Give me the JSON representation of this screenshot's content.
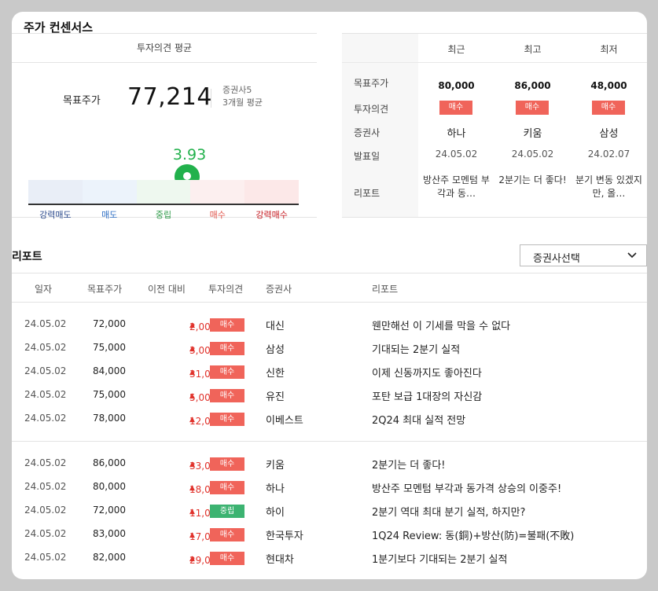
{
  "title": "주가 컨센서스",
  "summary": {
    "heading": "투자의견 평균",
    "target_label": "목표주가",
    "target_value": "77,214",
    "broker_count": "증권사5",
    "period": "3개월 평균",
    "score": "3.93",
    "score_fraction": 0.587,
    "gauge_labels": [
      "강력매도",
      "매도",
      "중립",
      "매수",
      "강력매수"
    ]
  },
  "comparison": {
    "row_labels": [
      "목표주가",
      "투자의견",
      "증권사",
      "발표일",
      "리포트"
    ],
    "columns": [
      {
        "header": "최근",
        "price": "80,000",
        "opinion": "매수",
        "broker": "하나",
        "date": "24.05.02",
        "report": "방산주 모멘텀 부각과 동…"
      },
      {
        "header": "최고",
        "price": "86,000",
        "opinion": "매수",
        "broker": "키움",
        "date": "24.05.02",
        "report": "2분기는 더 좋다!"
      },
      {
        "header": "최저",
        "price": "48,000",
        "opinion": "매수",
        "broker": "삼성",
        "date": "24.02.07",
        "report": "분기 변동 있겠지만, 올…"
      }
    ]
  },
  "reports": {
    "title": "리포트",
    "broker_select": "증권사선택",
    "headers": [
      "일자",
      "목표주가",
      "이전 대비",
      "투자의견",
      "증권사",
      "리포트"
    ],
    "rows": [
      {
        "date": "24.05.02",
        "price": "72,000",
        "diff": "2,000",
        "opinion": "매수",
        "broker": "대신",
        "title": "웬만해선 이 기세를 막을 수 없다"
      },
      {
        "date": "24.05.02",
        "price": "75,000",
        "diff": "3,000",
        "opinion": "매수",
        "broker": "삼성",
        "title": "기대되는 2분기 실적"
      },
      {
        "date": "24.05.02",
        "price": "84,000",
        "diff": "31,000",
        "opinion": "매수",
        "broker": "신한",
        "title": "이제 신동까지도 좋아진다"
      },
      {
        "date": "24.05.02",
        "price": "75,000",
        "diff": "5,000",
        "opinion": "매수",
        "broker": "유진",
        "title": "포탄 보급 1대장의 자신감"
      },
      {
        "date": "24.05.02",
        "price": "78,000",
        "diff": "12,000",
        "opinion": "매수",
        "broker": "이베스트",
        "title": "2Q24 최대 실적 전망"
      },
      {
        "date": "24.05.02",
        "price": "86,000",
        "diff": "33,000",
        "opinion": "매수",
        "broker": "키움",
        "title": "2분기는 더 좋다!"
      },
      {
        "date": "24.05.02",
        "price": "80,000",
        "diff": "18,000",
        "opinion": "매수",
        "broker": "하나",
        "title": "방산주 모멘텀 부각과 동가격 상승의 이중주!"
      },
      {
        "date": "24.05.02",
        "price": "72,000",
        "diff": "11,000",
        "opinion": "중립",
        "broker": "하이",
        "title": "2분기 역대 최대 분기 실적, 하지만?"
      },
      {
        "date": "24.05.02",
        "price": "83,000",
        "diff": "17,000",
        "opinion": "매수",
        "broker": "한국투자",
        "title": "1Q24 Review: 동(銅)+방산(防)=불패(不敗)"
      },
      {
        "date": "24.05.02",
        "price": "82,000",
        "diff": "29,000",
        "opinion": "매수",
        "broker": "현대차",
        "title": "1분기보다 기대되는 2분기 실적"
      }
    ]
  },
  "colors": {
    "buy": "#f0645a",
    "neutral": "#3cb371",
    "up": "#e0312a",
    "score": "#22b14c",
    "gauge": [
      "#e9eef7",
      "#ecf3fb",
      "#eef8ef",
      "#fcefef",
      "#fce8e8"
    ],
    "gauge_labels": [
      "#2b4a8c",
      "#2f6fc4",
      "#2e9b48",
      "#e0544a",
      "#c4161c"
    ]
  },
  "icons": {
    "pin": "location-pin-icon",
    "up": "triangle-up-icon",
    "chevron": "chevron-down-icon"
  }
}
